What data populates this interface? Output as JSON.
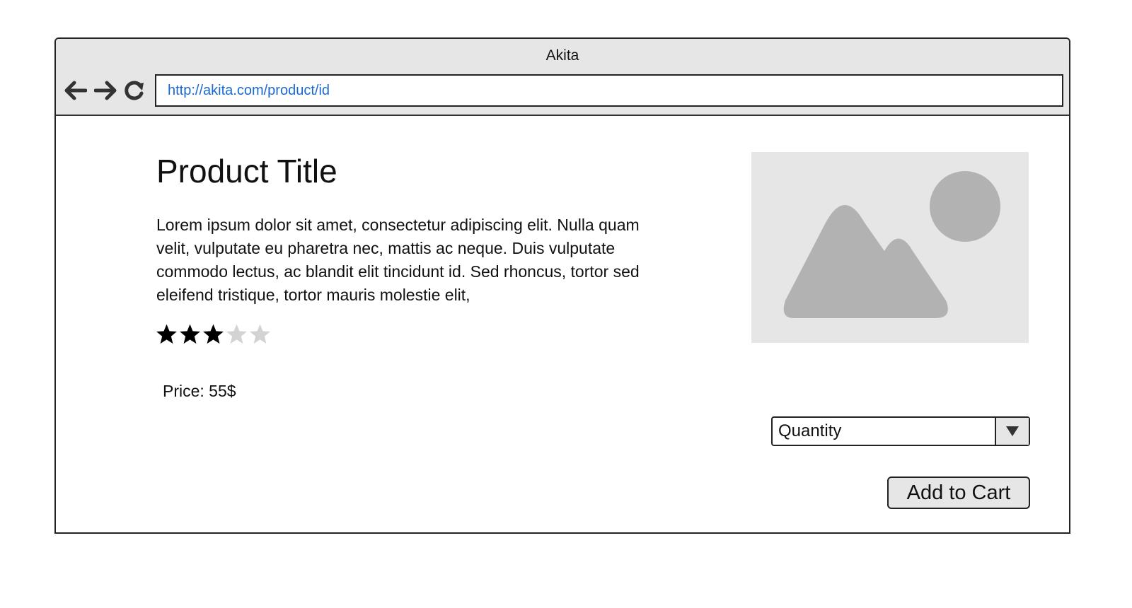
{
  "window": {
    "title": "Akita"
  },
  "toolbar": {
    "back_icon": "arrow-left-icon",
    "forward_icon": "arrow-right-icon",
    "reload_icon": "reload-icon",
    "url": "http://akita.com/product/id"
  },
  "product": {
    "title": "Product Title",
    "description": "Lorem ipsum dolor sit amet, consectetur adipiscing elit. Nulla quam velit, vulputate eu pharetra nec, mattis ac neque. Duis vulputate commodo lectus, ac blandit elit tincidunt id. Sed rhoncus, tortor sed eleifend tristique, tortor mauris molestie elit,",
    "rating": {
      "value": 3,
      "max": 5
    },
    "price": "Price: 55$",
    "image_icon": "image-placeholder-icon"
  },
  "purchase": {
    "quantity_label": "Quantity",
    "dropdown_icon": "chevron-down-icon",
    "add_to_cart_label": "Add to Cart"
  },
  "colors": {
    "url_text": "#1a6ad1",
    "chrome_bg": "#e6e6e6",
    "star_filled": "#000000",
    "star_empty": "#d3d3d3",
    "placeholder_shape": "#b2b2b2"
  }
}
